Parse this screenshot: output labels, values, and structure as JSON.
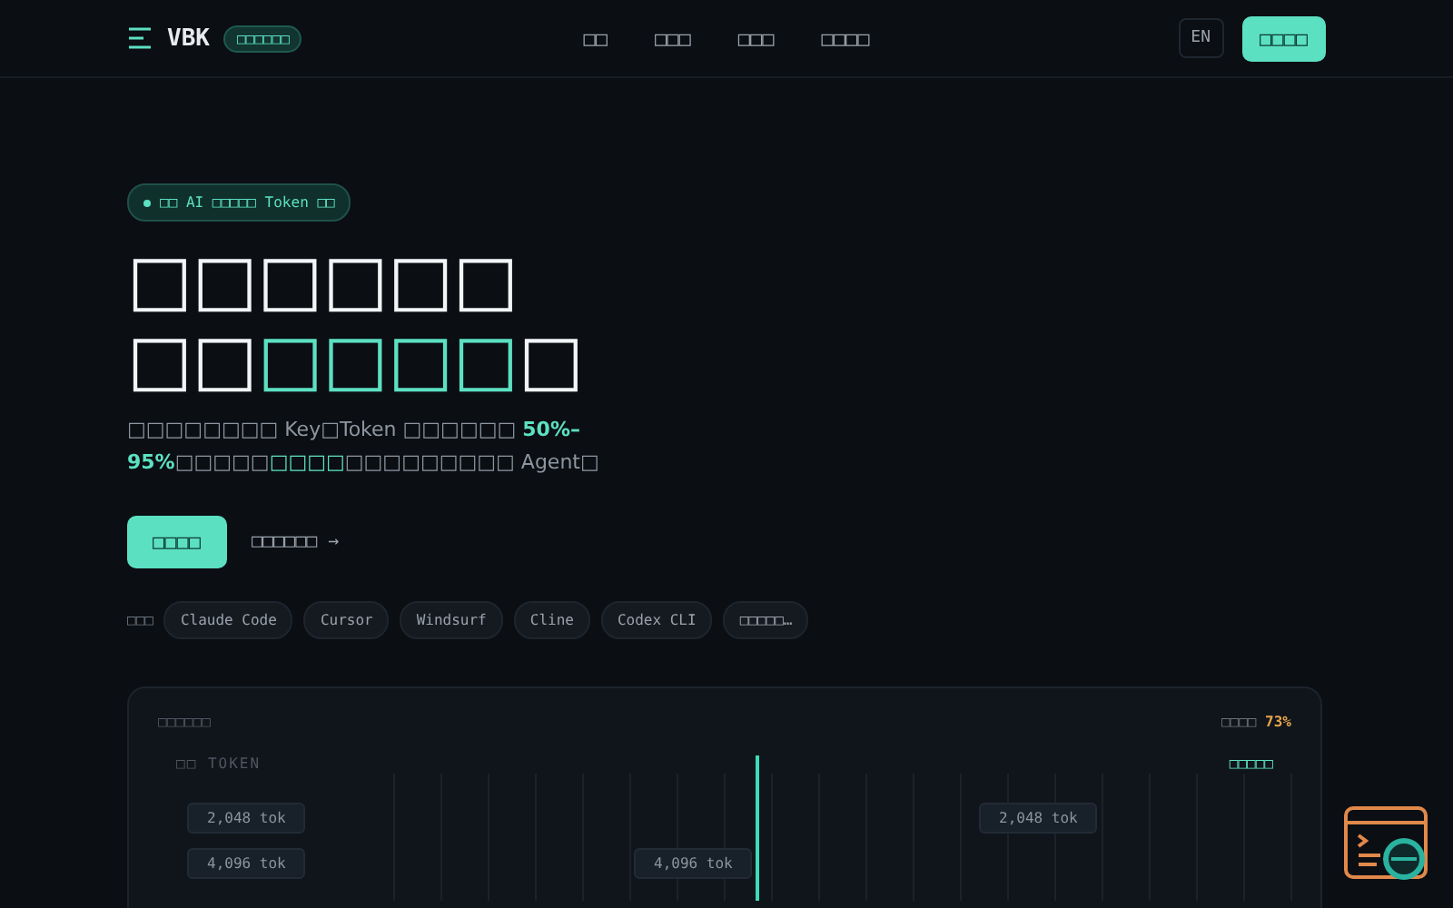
{
  "header": {
    "logo": "VBK",
    "badge": "□□□□□□",
    "nav": [
      "□□",
      "□□□",
      "□□□",
      "□□□□"
    ],
    "lang": "EN",
    "cta": "□□□□"
  },
  "hero": {
    "pill": "□□ AI □□□□□ Token □□",
    "headline": [
      {
        "text": "□□□□□□",
        "accent": false
      },
      {
        "text": "□□",
        "accent": false
      },
      {
        "text": "□□□□",
        "accent": true
      },
      {
        "text": "□",
        "accent": false
      }
    ],
    "lead": [
      {
        "text": "□□□□□□□□ Key□Token □□□□□□ ",
        "kind": "plain"
      },
      {
        "text": "50%–95%",
        "kind": "strong"
      },
      {
        "text": "□□□□□",
        "kind": "plain"
      },
      {
        "text": "□□□□",
        "kind": "accent"
      },
      {
        "text": "□□□□□□□□□ Agent□",
        "kind": "plain"
      }
    ],
    "primary_button": "□□□□",
    "secondary_link": "□□□□□□ →",
    "tools_label": "□□□",
    "tools": [
      "Claude Code",
      "Cursor",
      "Windsurf",
      "Cline",
      "Codex CLI",
      "□□□□□…"
    ]
  },
  "panel": {
    "title": "□□□□□□",
    "stat_label": "□□□□",
    "stat_value": "73%",
    "axis_label": "□□ TOKEN",
    "legend": "□□□□□",
    "chips": [
      "2,048 tok",
      "4,096 tok",
      "4,096 tok",
      "2,048 tok"
    ]
  }
}
